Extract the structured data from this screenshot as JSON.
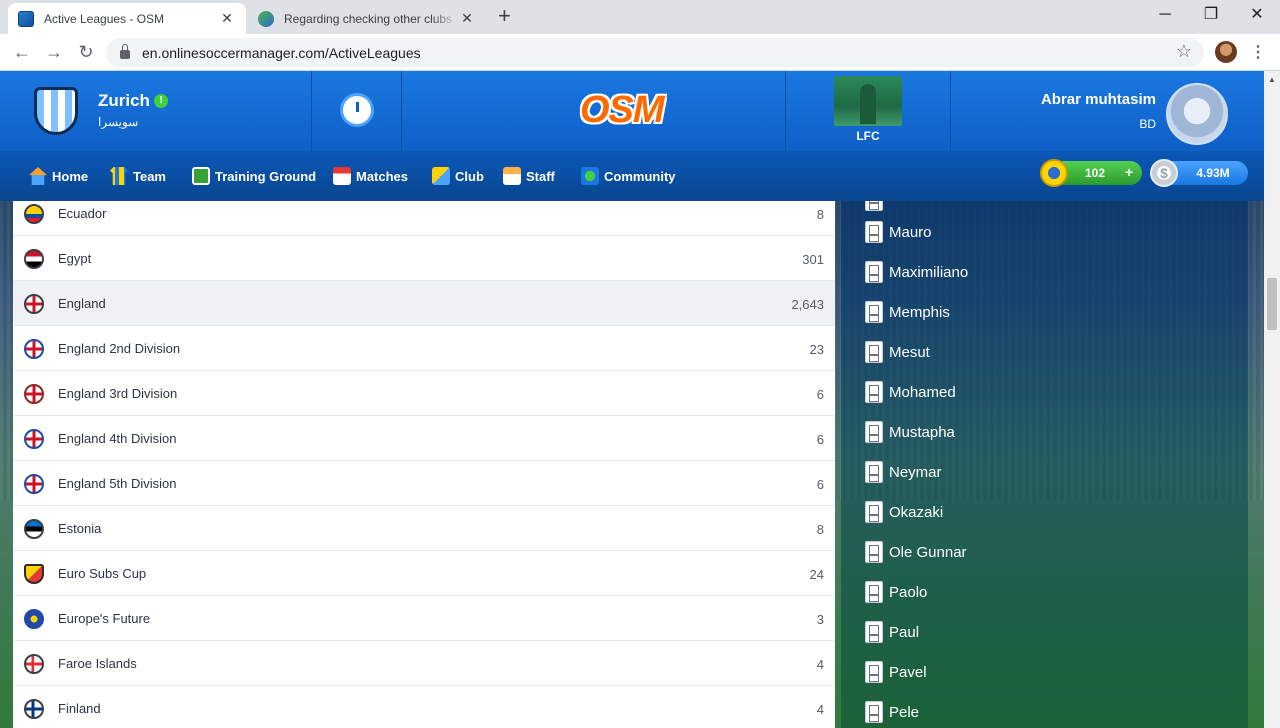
{
  "browser": {
    "tabs": [
      {
        "title": "Active Leagues - OSM",
        "close": "✕"
      },
      {
        "title": "Regarding checking other clubs i",
        "close": "✕"
      }
    ],
    "new_tab": "+",
    "window": {
      "minimize": "─",
      "maximize": "❐",
      "close": "✕"
    },
    "nav": {
      "back": "←",
      "forward": "→",
      "reload": "↻"
    },
    "url": "en.onlinesoccermanager.com/ActiveLeagues",
    "bookmark": "☆",
    "menu": "⋮"
  },
  "header": {
    "club_name": "Zurich",
    "club_status": "!",
    "club_subtitle": "سويسرا",
    "logo_text": "OSM",
    "featured_club": "LFC",
    "manager_name": "Abrar muhtasim",
    "manager_country": "BD"
  },
  "nav": {
    "items": [
      {
        "label": "Home",
        "icon": "home-icon"
      },
      {
        "label": "Team",
        "icon": "shirt-icon"
      },
      {
        "label": "Training Ground",
        "icon": "pitch-icon"
      },
      {
        "label": "Matches",
        "icon": "calendar-icon"
      },
      {
        "label": "Club",
        "icon": "shield-icon"
      },
      {
        "label": "Staff",
        "icon": "staff-icon"
      },
      {
        "label": "Community",
        "icon": "globe-icon"
      }
    ],
    "boss_coins": "102",
    "boss_plus": "+",
    "cash_symbol": "$",
    "cash": "4.93M"
  },
  "leagues": [
    {
      "name": "Ecuador",
      "count": "8"
    },
    {
      "name": "Egypt",
      "count": "301"
    },
    {
      "name": "England",
      "count": "2,643"
    },
    {
      "name": "England 2nd Division",
      "count": "23"
    },
    {
      "name": "England 3rd Division",
      "count": "6"
    },
    {
      "name": "England 4th Division",
      "count": "6"
    },
    {
      "name": "England 5th Division",
      "count": "6"
    },
    {
      "name": "Estonia",
      "count": "8"
    },
    {
      "name": "Euro Subs Cup",
      "count": "24"
    },
    {
      "name": "Europe's Future",
      "count": "3"
    },
    {
      "name": "Faroe Islands",
      "count": "4"
    },
    {
      "name": "Finland",
      "count": "4"
    }
  ],
  "names": [
    "Mauro",
    "Maximiliano",
    "Memphis",
    "Mesut",
    "Mohamed",
    "Mustapha",
    "Neymar",
    "Okazaki",
    "Ole Gunnar",
    "Paolo",
    "Paul",
    "Pavel",
    "Pele"
  ],
  "colors": {
    "brand_blue": "#1a78e0",
    "nav_blue": "#0b58b8",
    "accent_orange": "#ff6a00",
    "boss_green": "#3fb33f"
  }
}
